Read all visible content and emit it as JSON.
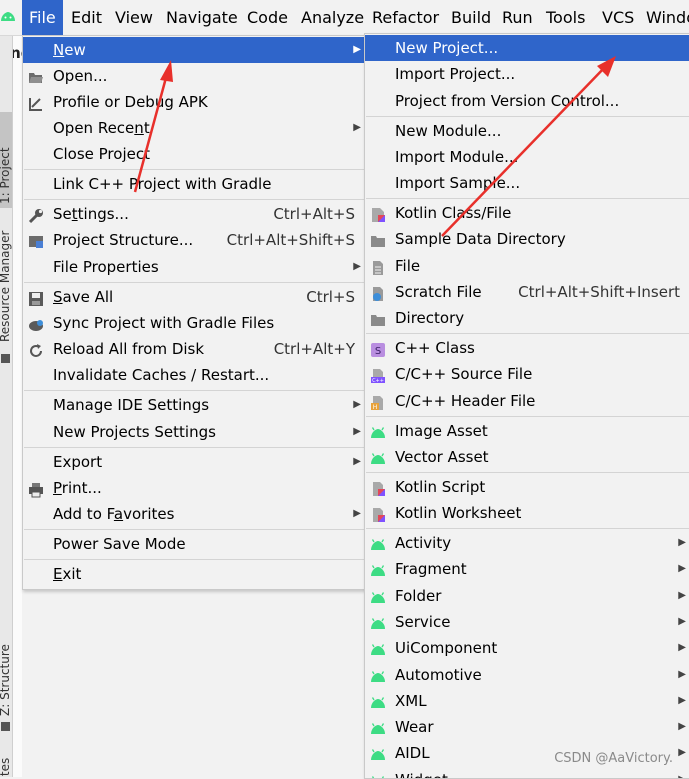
{
  "menubar": {
    "items": [
      "File",
      "Edit",
      "View",
      "Navigate",
      "Code",
      "Analyze",
      "Refactor",
      "Build",
      "Run",
      "Tools",
      "VCS",
      "Windo"
    ],
    "active": "File",
    "accent": "#2f65ca"
  },
  "side_tabs": {
    "project": "1: Project",
    "resource_manager": "Resource Manager",
    "structure": "Z: Structure",
    "favorites": "Favorites"
  },
  "editor_title_fragment": "and",
  "file_menu": [
    {
      "label": "New",
      "icon": "",
      "shortcut": "",
      "submenu": true,
      "selected": true
    },
    {
      "label": "Open...",
      "icon": "folder-open-icon",
      "shortcut": "",
      "submenu": false
    },
    {
      "label": "Profile or Debug APK",
      "icon": "apk-debug-icon",
      "shortcut": "",
      "submenu": false
    },
    {
      "label": "Open Recent",
      "icon": "",
      "shortcut": "",
      "submenu": true
    },
    {
      "label": "Close Project",
      "icon": "",
      "shortcut": "",
      "submenu": false
    },
    {
      "label": "Link C++ Project with Gradle",
      "icon": "",
      "shortcut": "",
      "submenu": false
    },
    {
      "label": "Settings...",
      "icon": "wrench-icon",
      "shortcut": "Ctrl+Alt+S",
      "submenu": false
    },
    {
      "label": "Project Structure...",
      "icon": "project-structure-icon",
      "shortcut": "Ctrl+Alt+Shift+S",
      "submenu": false
    },
    {
      "label": "File Properties",
      "icon": "",
      "shortcut": "",
      "submenu": true
    },
    {
      "label": "Save All",
      "icon": "floppy-disk-icon",
      "shortcut": "Ctrl+S",
      "submenu": false
    },
    {
      "label": "Sync Project with Gradle Files",
      "icon": "gradle-sync-icon",
      "shortcut": "",
      "submenu": false
    },
    {
      "label": "Reload All from Disk",
      "icon": "reload-icon",
      "shortcut": "Ctrl+Alt+Y",
      "submenu": false
    },
    {
      "label": "Invalidate Caches / Restart...",
      "icon": "",
      "shortcut": "",
      "submenu": false
    },
    {
      "label": "Manage IDE Settings",
      "icon": "",
      "shortcut": "",
      "submenu": true
    },
    {
      "label": "New Projects Settings",
      "icon": "",
      "shortcut": "",
      "submenu": true
    },
    {
      "label": "Export",
      "icon": "",
      "shortcut": "",
      "submenu": true
    },
    {
      "label": "Print...",
      "icon": "printer-icon",
      "shortcut": "",
      "submenu": false
    },
    {
      "label": "Add to Favorites",
      "icon": "",
      "shortcut": "",
      "submenu": true
    },
    {
      "label": "Power Save Mode",
      "icon": "",
      "shortcut": "",
      "submenu": false
    },
    {
      "label": "Exit",
      "icon": "",
      "shortcut": "",
      "submenu": false
    }
  ],
  "new_submenu": [
    {
      "label": "New Project...",
      "icon": "",
      "shortcut": "",
      "submenu": false,
      "selected": true
    },
    {
      "label": "Import Project...",
      "icon": "",
      "shortcut": "",
      "submenu": false
    },
    {
      "label": "Project from Version Control...",
      "icon": "",
      "shortcut": "",
      "submenu": false
    },
    {
      "label": "New Module...",
      "icon": "",
      "shortcut": "",
      "submenu": false
    },
    {
      "label": "Import Module...",
      "icon": "",
      "shortcut": "",
      "submenu": false
    },
    {
      "label": "Import Sample...",
      "icon": "",
      "shortcut": "",
      "submenu": false
    },
    {
      "label": "Kotlin Class/File",
      "icon": "kotlin-file-icon",
      "shortcut": "",
      "submenu": false
    },
    {
      "label": "Sample Data Directory",
      "icon": "folder-icon",
      "shortcut": "",
      "submenu": false
    },
    {
      "label": "File",
      "icon": "file-icon",
      "shortcut": "",
      "submenu": false
    },
    {
      "label": "Scratch File",
      "icon": "scratch-file-icon",
      "shortcut": "Ctrl+Alt+Shift+Insert",
      "submenu": false
    },
    {
      "label": "Directory",
      "icon": "folder-icon",
      "shortcut": "",
      "submenu": false
    },
    {
      "label": "C++ Class",
      "icon": "cpp-class-icon",
      "shortcut": "",
      "submenu": false
    },
    {
      "label": "C/C++ Source File",
      "icon": "cpp-source-icon",
      "shortcut": "",
      "submenu": false
    },
    {
      "label": "C/C++ Header File",
      "icon": "cpp-header-icon",
      "shortcut": "",
      "submenu": false
    },
    {
      "label": "Image Asset",
      "icon": "android-icon",
      "shortcut": "",
      "submenu": false
    },
    {
      "label": "Vector Asset",
      "icon": "android-icon",
      "shortcut": "",
      "submenu": false
    },
    {
      "label": "Kotlin Script",
      "icon": "kotlin-script-icon",
      "shortcut": "",
      "submenu": false
    },
    {
      "label": "Kotlin Worksheet",
      "icon": "kotlin-script-icon",
      "shortcut": "",
      "submenu": false
    },
    {
      "label": "Activity",
      "icon": "android-icon",
      "shortcut": "",
      "submenu": true
    },
    {
      "label": "Fragment",
      "icon": "android-icon",
      "shortcut": "",
      "submenu": true
    },
    {
      "label": "Folder",
      "icon": "android-icon",
      "shortcut": "",
      "submenu": true
    },
    {
      "label": "Service",
      "icon": "android-icon",
      "shortcut": "",
      "submenu": true
    },
    {
      "label": "UiComponent",
      "icon": "android-icon",
      "shortcut": "",
      "submenu": true
    },
    {
      "label": "Automotive",
      "icon": "android-icon",
      "shortcut": "",
      "submenu": true
    },
    {
      "label": "XML",
      "icon": "android-icon",
      "shortcut": "",
      "submenu": true
    },
    {
      "label": "Wear",
      "icon": "android-icon",
      "shortcut": "",
      "submenu": true
    },
    {
      "label": "AIDL",
      "icon": "android-icon",
      "shortcut": "",
      "submenu": true
    },
    {
      "label": "Widget",
      "icon": "android-icon",
      "shortcut": "",
      "submenu": true
    }
  ],
  "watermark": "CSDN @AaVictory.",
  "colors": {
    "menu_bg": "#f2f2f2",
    "selection": "#2f65ca",
    "android_green": "#3ddc84",
    "annotation_arrow": "#e8302b"
  }
}
